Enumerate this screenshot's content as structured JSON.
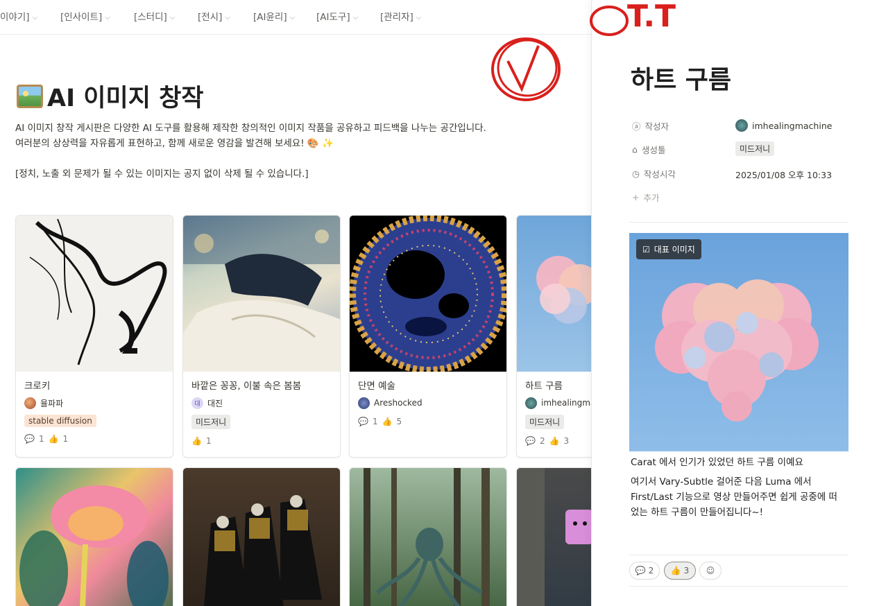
{
  "nav": {
    "items": [
      "이야기]",
      "[인사이트]",
      "[스터디]",
      "[전시]",
      "[AI윤리]",
      "[AI도구]",
      "[관리자]"
    ]
  },
  "page": {
    "title": "AI 이미지 창작",
    "description": "AI 이미지 창작 게시판은 다양한 AI 도구를 활용해 제작한 창의적인 이미지 작품을 공유하고 피드백을 나누는 공간입니다.\n여러분의 상상력을 자유롭게 표현하고, 함께 새로운 영감을 발견해 보세요! 🎨 ✨\n\n[정치, 노출 외 문제가 될 수 있는 이미지는 공지 없이 삭제 될 수 있습니다.]"
  },
  "cards": [
    {
      "title": "크로키",
      "author": "율파파",
      "tag": "stable diffusion",
      "comments": "1",
      "likes": "1"
    },
    {
      "title": "바깥은 꽁꽁, 이불 속은 봄봄",
      "author": "대진",
      "avatar_letter": "대",
      "tag": "미드저니",
      "likes": "1"
    },
    {
      "title": "단면 예술",
      "author": "Areshocked",
      "comments": "1",
      "likes": "5"
    },
    {
      "title": "하트 구름",
      "author": "imhealingmac",
      "tag": "미드저니",
      "comments": "2",
      "likes": "3"
    }
  ],
  "panel": {
    "title": "하트 구름",
    "props": {
      "author_label": "작성자",
      "author_value": "imhealingmachine",
      "tool_label": "생성툴",
      "tool_value": "미드저니",
      "time_label": "작성시각",
      "time_value": "2025/01/08 오후 10:33",
      "add_label": "추가"
    },
    "badge": "대표 이미지",
    "text1": "Carat 에서 인기가 있었던 하트 구름 이예요",
    "text2": "여기서 Vary-Subtle 걸어준 다음 Luma 에서 First/Last 기능으로 영상 만들어주면 쉽게 공중에 떠었는 하트 구름이 만들어집니다~!",
    "comments": "2",
    "likes": "3"
  },
  "annotation_text": "T.T",
  "colors": {
    "annotation": "#d9201c",
    "tag_orange": "#fbe4d4",
    "tag_gray": "#ebebea"
  }
}
